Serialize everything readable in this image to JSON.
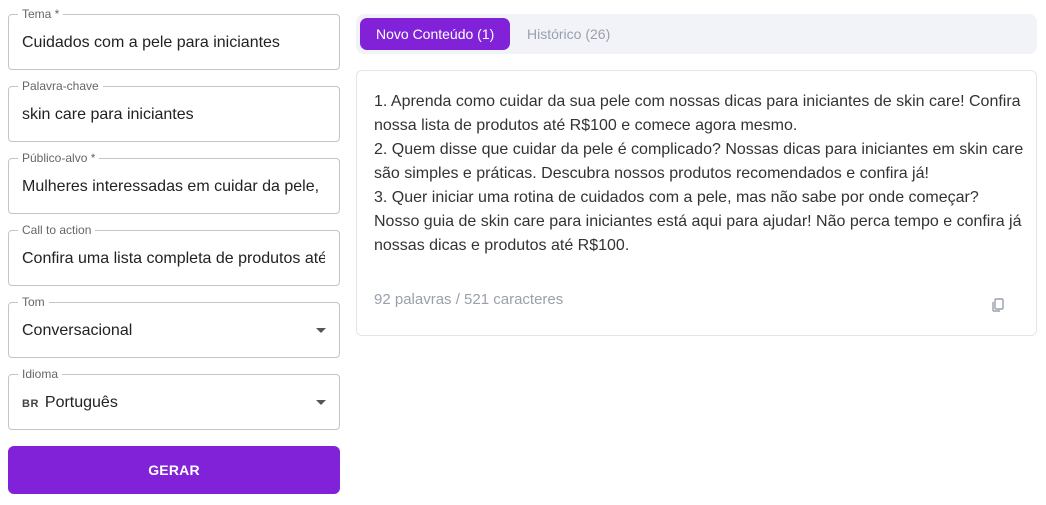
{
  "form": {
    "theme": {
      "label": "Tema *",
      "value": "Cuidados com a pele para iniciantes"
    },
    "keyword": {
      "label": "Palavra-chave",
      "value": "skin care para iniciantes"
    },
    "audience": {
      "label": "Público-alvo *",
      "value": "Mulheres interessadas em cuidar da pele,"
    },
    "cta": {
      "label": "Call to action",
      "value": "Confira uma lista completa de produtos até"
    },
    "tone": {
      "label": "Tom",
      "value": "Conversacional"
    },
    "language": {
      "label": "Idioma",
      "flag": "BR",
      "value": "Português"
    },
    "generate_label": "GERAR"
  },
  "tabs": [
    {
      "label": "Novo Conteúdo (1)",
      "active": true
    },
    {
      "label": "Histórico (26)",
      "active": false
    }
  ],
  "result": {
    "paragraphs": [
      "1. Aprenda como cuidar da sua pele com nossas dicas para iniciantes de skin care! Confira nossa lista de produtos até R$100 e comece agora mesmo.",
      "2. Quem disse que cuidar da pele é complicado? Nossas dicas para iniciantes em skin care são simples e práticas. Descubra nossos produtos recomendados e confira já!",
      "3. Quer iniciar uma rotina de cuidados com a pele, mas não sabe por onde começar? Nosso guia de skin care para iniciantes está aqui para ajudar! Não perca tempo e confira já nossas dicas e produtos até R$100."
    ],
    "stats": "92 palavras / 521 caracteres",
    "copy_icon": "copy-icon"
  },
  "colors": {
    "accent": "#8222d8",
    "tab_bg": "#f1f3f8",
    "muted": "#9aa0ab"
  }
}
